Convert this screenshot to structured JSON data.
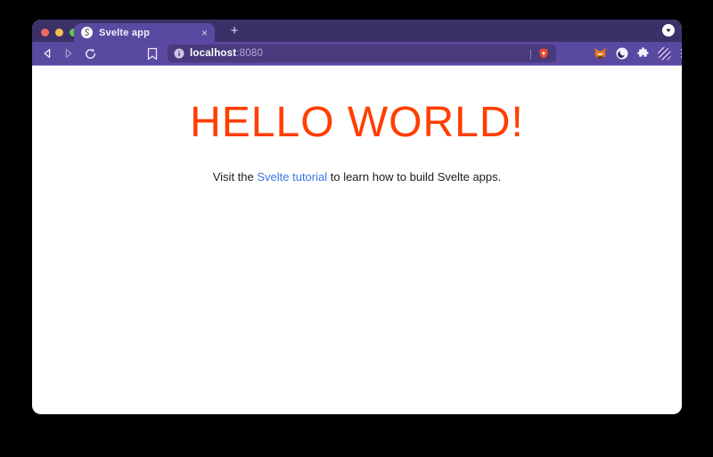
{
  "theme": {
    "frame_dark": "#3c3068",
    "frame": "#5a49a0",
    "urlbar_bg": "#483a7d",
    "accent": "#ff3e00",
    "link_color": "#3b78e7",
    "shield_color": "#e8492f",
    "traffic_red": "#ee6a5f",
    "traffic_yellow": "#f5bd4f",
    "traffic_green": "#61c554"
  },
  "tabbar": {
    "tab": {
      "title": "Svelte app",
      "close_glyph": "×"
    },
    "new_tab_glyph": "+"
  },
  "toolbar": {
    "address": {
      "host": "localhost",
      "port": ":8080",
      "separator": "|"
    }
  },
  "page": {
    "heading": "HELLO WORLD!",
    "paragraph": {
      "prefix": "Visit the ",
      "link_text": "Svelte tutorial",
      "suffix": " to learn how to build Svelte apps."
    }
  }
}
